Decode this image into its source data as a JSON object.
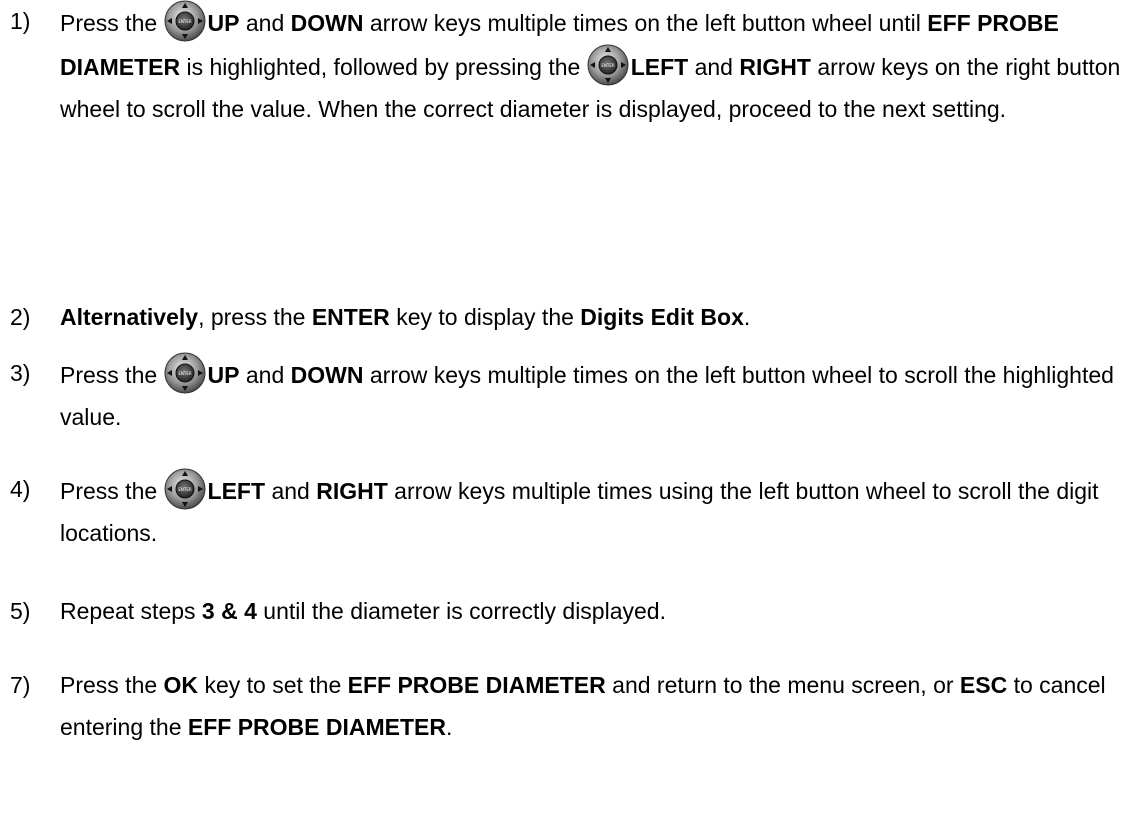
{
  "steps": [
    {
      "number": "1)",
      "text": {
        "pre": "Press the",
        "k1": "UP",
        "and1": "and",
        "k2": "DOWN",
        "mid1": "arrow keys multiple times on the left button wheel until",
        "k3": "EFF PROBE DIAMETER",
        "mid2": "is highlighted, followed by pressing the",
        "k4": "LEFT",
        "and2": "and",
        "k5": "RIGHT",
        "tail": "arrow keys on the right button wheel to scroll the value.  When the correct diameter is displayed, proceed to the next setting."
      }
    },
    {
      "number": "2)",
      "text": {
        "k1": "Alternatively",
        "mid1": ", press the",
        "k2": "ENTER",
        "mid2": "key to display the",
        "k3": "Digits Edit Box",
        "tail": "."
      }
    },
    {
      "number": "3)",
      "text": {
        "pre": "Press the",
        "k1": "UP",
        "and1": "and",
        "k2": "DOWN",
        "tail": "arrow keys multiple times on the left button wheel to scroll the highlighted value."
      }
    },
    {
      "number": "4)",
      "text": {
        "pre": "Press the",
        "k1": "LEFT",
        "and1": "and",
        "k2": "RIGHT",
        "tail": "arrow keys multiple times using the left button wheel to scroll the digit locations."
      }
    },
    {
      "number": "5)",
      "text": {
        "pre": "Repeat steps",
        "k1": "3 & 4",
        "tail": "until the diameter is correctly displayed."
      }
    },
    {
      "number": "7)",
      "text": {
        "pre": "Press the",
        "k1": "OK",
        "mid1": "key to set the",
        "k2": "EFF PROBE DIAMETER",
        "mid2": "and return to the menu screen, or",
        "k3": "ESC",
        "mid3": "to cancel entering the",
        "k4": "EFF PROBE DIAMETER",
        "tail": "."
      }
    }
  ],
  "icons": {
    "wheel_icon": "button-wheel-icon",
    "wheel_center_label": "ENTER",
    "colors": {
      "wheel_dark": "#5a5a5a",
      "wheel_light": "#d8d8d8",
      "center": "#444444"
    }
  }
}
